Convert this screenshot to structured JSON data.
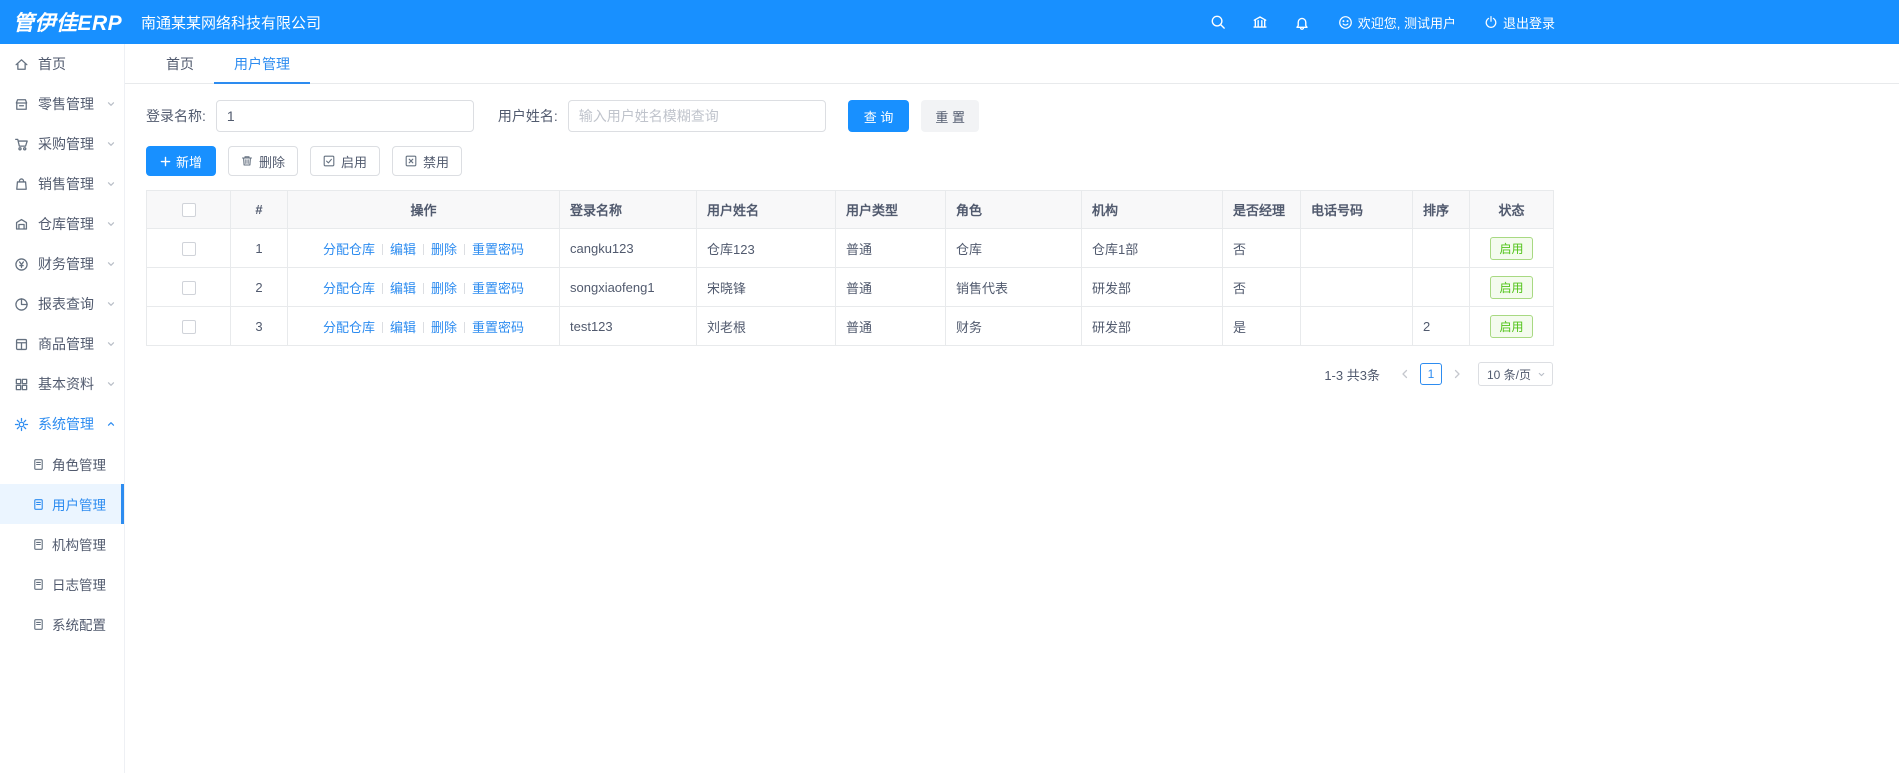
{
  "header": {
    "logo": "管伊佳ERP",
    "company": "南通某某网络科技有限公司",
    "welcome": "欢迎您, 测试用户",
    "logout": "退出登录"
  },
  "sidebar": {
    "items": [
      {
        "label": "首页"
      },
      {
        "label": "零售管理"
      },
      {
        "label": "采购管理"
      },
      {
        "label": "销售管理"
      },
      {
        "label": "仓库管理"
      },
      {
        "label": "财务管理"
      },
      {
        "label": "报表查询"
      },
      {
        "label": "商品管理"
      },
      {
        "label": "基本资料"
      },
      {
        "label": "系统管理"
      }
    ],
    "system_children": [
      {
        "label": "角色管理"
      },
      {
        "label": "用户管理"
      },
      {
        "label": "机构管理"
      },
      {
        "label": "日志管理"
      },
      {
        "label": "系统配置"
      }
    ]
  },
  "tabs": [
    {
      "label": "首页"
    },
    {
      "label": "用户管理"
    }
  ],
  "search": {
    "login_label": "登录名称:",
    "login_value": "1",
    "name_label": "用户姓名:",
    "name_placeholder": "输入用户姓名模糊查询",
    "query": "查 询",
    "reset": "重 置"
  },
  "toolbar": {
    "add": "新增",
    "delete": "删除",
    "enable": "启用",
    "disable": "禁用"
  },
  "table": {
    "headers": {
      "index": "#",
      "actions": "操作",
      "login": "登录名称",
      "name": "用户姓名",
      "type": "用户类型",
      "role": "角色",
      "org": "机构",
      "manager": "是否经理",
      "phone": "电话号码",
      "sort": "排序",
      "status": "状态"
    },
    "action_links": {
      "assign": "分配仓库",
      "edit": "编辑",
      "delete": "删除",
      "reset_pwd": "重置密码"
    },
    "rows": [
      {
        "index": "1",
        "login": "cangku123",
        "name": "仓库123",
        "type": "普通",
        "role": "仓库",
        "org": "仓库1部",
        "manager": "否",
        "phone": "",
        "sort": "",
        "status": "启用"
      },
      {
        "index": "2",
        "login": "songxiaofeng1",
        "name": "宋晓锋",
        "type": "普通",
        "role": "销售代表",
        "org": "研发部",
        "manager": "否",
        "phone": "",
        "sort": "",
        "status": "启用"
      },
      {
        "index": "3",
        "login": "test123",
        "name": "刘老根",
        "type": "普通",
        "role": "财务",
        "org": "研发部",
        "manager": "是",
        "phone": "",
        "sort": "2",
        "status": "启用"
      }
    ]
  },
  "pagination": {
    "total": "1-3 共3条",
    "current_page": "1",
    "page_size": "10 条/页"
  },
  "colors": {
    "header_blue": "#1890ff",
    "link_blue": "#2d8cf0",
    "success_green": "#52c41a"
  }
}
